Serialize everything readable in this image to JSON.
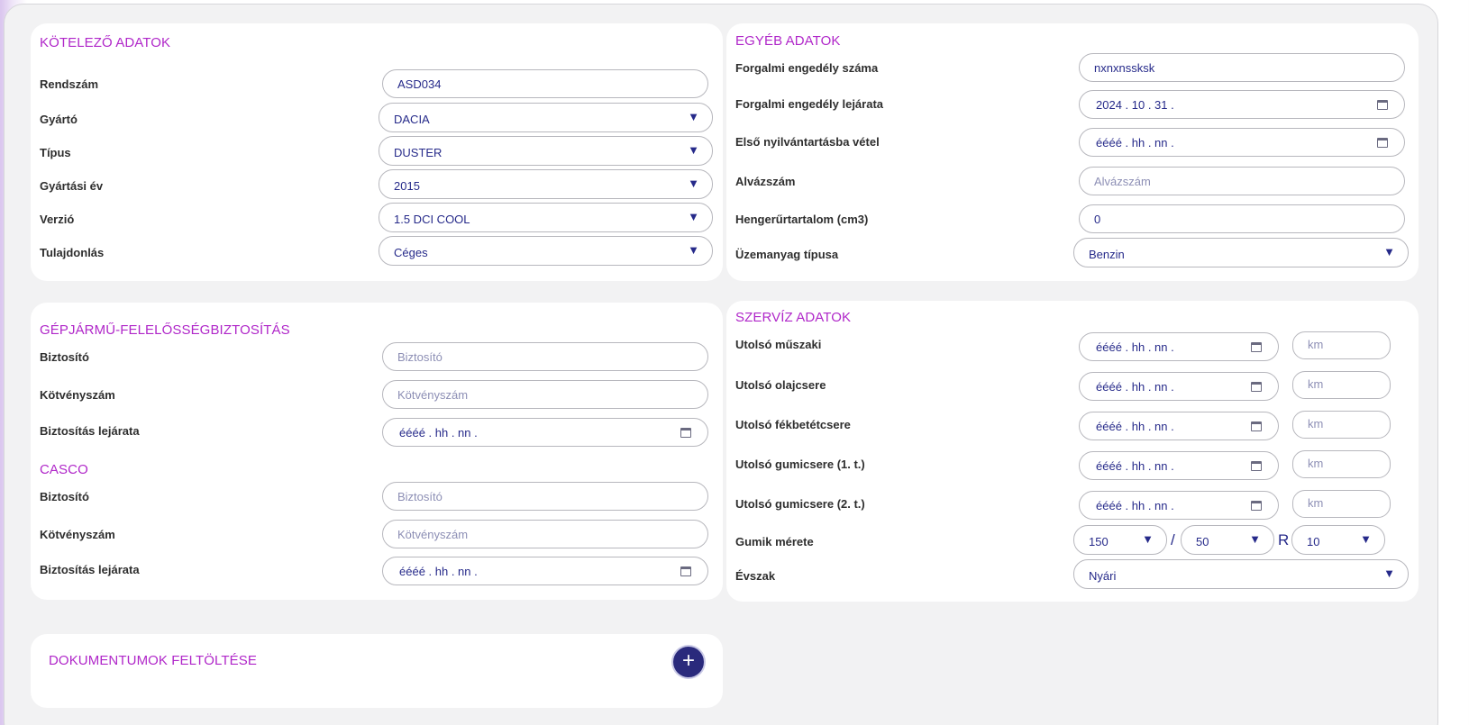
{
  "mandatory": {
    "title": "KÖTELEZŐ ADATOK",
    "plate_label": "Rendszám",
    "plate_value": "ASD034",
    "maker_label": "Gyártó",
    "maker_value": "DACIA",
    "type_label": "Típus",
    "type_value": "DUSTER",
    "year_label": "Gyártási év",
    "year_value": "2015",
    "version_label": "Verzió",
    "version_value": "1.5 DCI COOL",
    "owner_label": "Tulajdonlás",
    "owner_value": "Céges"
  },
  "other": {
    "title": "EGYÉB ADATOK",
    "reg_no_label": "Forgalmi engedély száma",
    "reg_no_value": "nxnxnssksk",
    "reg_exp_label": "Forgalmi engedély lejárata",
    "reg_exp_value": "2024 . 10 . 31 .",
    "first_reg_label": "Első nyilvántartásba vétel",
    "first_reg_value": "éééé . hh . nn .",
    "vin_label": "Alvázszám",
    "vin_placeholder": "Alvázszám",
    "cc_label": "Hengerűrtartalom (cm3)",
    "cc_value": "0",
    "fuel_label": "Üzemanyag típusa",
    "fuel_value": "Benzin"
  },
  "liability": {
    "title": "GÉPJÁRMŰ-FELELŐSSÉGBIZTOSÍTÁS",
    "insurer_label": "Biztosító",
    "insurer_placeholder": "Biztosító",
    "policy_label": "Kötvényszám",
    "policy_placeholder": "Kötvényszám",
    "expiry_label": "Biztosítás lejárata",
    "expiry_value": "éééé . hh . nn ."
  },
  "casco": {
    "title": "CASCO",
    "insurer_label": "Biztosító",
    "insurer_placeholder": "Biztosító",
    "policy_label": "Kötvényszám",
    "policy_placeholder": "Kötvényszám",
    "expiry_label": "Biztosítás lejárata",
    "expiry_value": "éééé . hh . nn ."
  },
  "service": {
    "title": "SZERVÍZ ADATOK",
    "date_placeholder": "éééé . hh . nn .",
    "km_placeholder": "km",
    "rows": [
      {
        "label": "Utolsó műszaki"
      },
      {
        "label": "Utolsó olajcsere"
      },
      {
        "label": "Utolsó fékbetétcsere"
      },
      {
        "label": "Utolsó gumicsere (1. t.)"
      },
      {
        "label": "Utolsó gumicsere (2. t.)"
      }
    ],
    "tire_label": "Gumik mérete",
    "tire_width": "150",
    "tire_sep": "/",
    "tire_ratio": "50",
    "tire_r": "R",
    "tire_rim": "10",
    "season_label": "Évszak",
    "season_value": "Nyári"
  },
  "documents": {
    "title": "DOKUMENTUMOK FELTÖLTÉSE",
    "add_glyph": "+"
  },
  "icons": {
    "dropdown": "▼"
  },
  "colors": {
    "accent": "#b027c9",
    "text_value": "#262a8a",
    "button": "#2a2a7c"
  }
}
